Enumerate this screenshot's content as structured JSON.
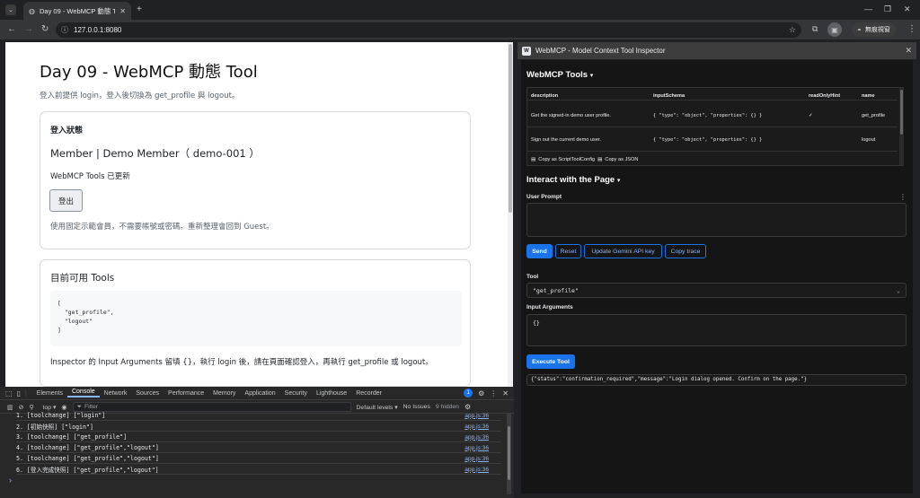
{
  "browser": {
    "tab_title": "Day 09 - WebMCP 動態 Tool",
    "new_tab_label": "+",
    "url": "127.0.0.1:8080",
    "incognito_label": "無痕視窗"
  },
  "page": {
    "title": "Day 09 - WebMCP 動態 Tool",
    "subtitle": "登入前提供 login，登入後切換為 get_profile 與 logout。",
    "login_card": {
      "heading": "登入狀態",
      "member": "Member | Demo Member（ demo-001 ）",
      "status": "WebMCP Tools 已更新",
      "logout_button": "登出",
      "hint": "使用固定示範會員，不需要帳號或密碼。重新整理會回到 Guest。"
    },
    "tools_card": {
      "heading": "目前可用 Tools",
      "code_lines": [
        "[",
        "  \"get_profile\",",
        "  \"logout\"",
        "]"
      ],
      "note": "Inspector 的 Input Arguments 留填 {}，執行 login 後，請在頁面確認登入，再執行 get_profile 或 logout。"
    }
  },
  "devtools": {
    "tabs": [
      "Elements",
      "Console",
      "Network",
      "Sources",
      "Performance",
      "Memory",
      "Application",
      "Security",
      "Lighthouse",
      "Recorder"
    ],
    "active_tab": "Console",
    "context": "top",
    "filter_placeholder": "Filter",
    "levels": "Default levels",
    "issues": "No Issues",
    "hidden": "9 hidden",
    "badge_count": "1",
    "logs": [
      {
        "text": "1. [toolchange] [\"login\"]",
        "src": "app.js:36"
      },
      {
        "text": "2. [初始快照] [\"login\"]",
        "src": "app.js:36"
      },
      {
        "text": "3. [toolchange] [\"get_profile\"]",
        "src": "app.js:36"
      },
      {
        "text": "4. [toolchange] [\"get_profile\",\"logout\"]",
        "src": "app.js:36"
      },
      {
        "text": "5. [toolchange] [\"get_profile\",\"logout\"]",
        "src": "app.js:36"
      },
      {
        "text": "6. [登入完成快照] [\"get_profile\",\"logout\"]",
        "src": "app.js:36"
      }
    ],
    "prompt": "›"
  },
  "inspector": {
    "window_title": "WebMCP - Model Context Tool Inspector",
    "tools_heading": "WebMCP Tools",
    "table": {
      "headers": [
        "description",
        "inputSchema",
        "readOnlyHint",
        "name"
      ],
      "rows": [
        {
          "description": "Get the signed-in demo user profile.",
          "schema": "{ \"type\": \"object\", \"properties\": {} }",
          "readonly": "✓",
          "name": "get_profile"
        },
        {
          "description": "Sign out the current demo user.",
          "schema": "{ \"type\": \"object\", \"properties\": {} }",
          "readonly": "",
          "name": "logout"
        }
      ],
      "copy_config": "Copy as ScriptToolConfig",
      "copy_json": "Copy as JSON"
    },
    "interact_heading": "Interact with the Page",
    "user_prompt_label": "User Prompt",
    "buttons": {
      "send": "Send",
      "reset": "Reset",
      "update_key": "Update Gemini API key",
      "copy_trace": "Copy trace"
    },
    "tool_label": "Tool",
    "tool_selected": "\"get_profile\"",
    "input_args_label": "Input Arguments",
    "input_args_value": "{}",
    "execute_button": "Execute Tool",
    "result": "{\"status\":\"confirmation_required\",\"message\":\"Login dialog opened. Confirm on the page.\"}"
  }
}
